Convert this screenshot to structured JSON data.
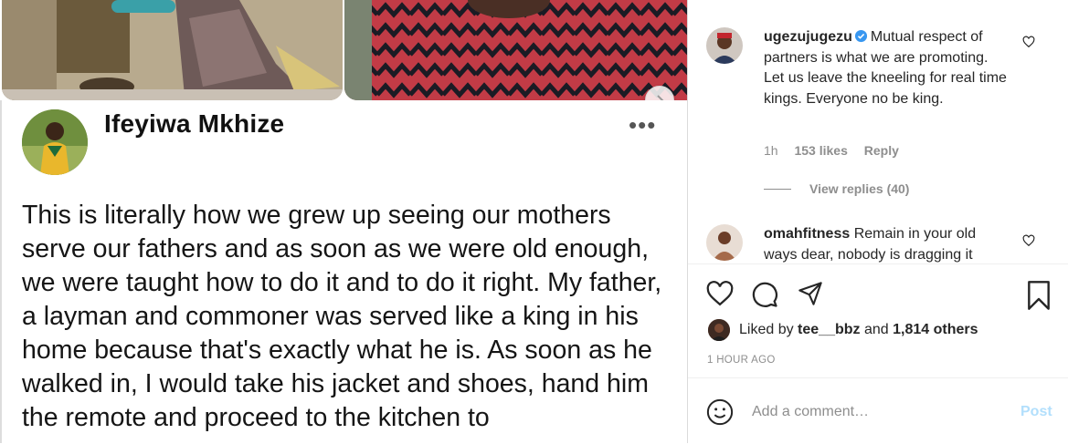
{
  "post": {
    "author_name": "Ifeyiwa Mkhize",
    "more_icon": "more-horizontal-icon",
    "text": "This is literally how we grew up seeing our mothers serve our fathers and as soon as we were old enough, we were taught how to do it and to do it right. My father, a layman and commoner was served like a king in his home because that's exactly what he is. As soon as he walked in, I would take his jacket and shoes, hand him the remote and proceed to the kitchen to"
  },
  "carousel": {
    "next_icon": "chevron-right-icon"
  },
  "comments": [
    {
      "username": "ugezujugezu",
      "verified": true,
      "text": "Mutual respect of partners is what we are promoting. Let us leave the kneeling for real time kings. Everyone no be king.",
      "time": "1h",
      "likes": "153 likes",
      "reply": "Reply",
      "view_replies": "View replies (40)"
    },
    {
      "username": "omahfitness",
      "verified": false,
      "text": "Remain in your old ways dear, nobody is dragging it"
    }
  ],
  "actions": {
    "like_icon": "heart-icon",
    "comment_icon": "comment-icon",
    "share_icon": "share-icon",
    "save_icon": "bookmark-icon"
  },
  "likes": {
    "prefix": "Liked by",
    "user": "tee__bbz",
    "and": "and",
    "others": "1,814 others"
  },
  "timestamp": "1 HOUR AGO",
  "comment_box": {
    "placeholder": "Add a comment…",
    "post_label": "Post"
  },
  "colors": {
    "verified": "#3897f0",
    "post_disabled": "#b2dffc",
    "muted": "#8e8e8e"
  }
}
